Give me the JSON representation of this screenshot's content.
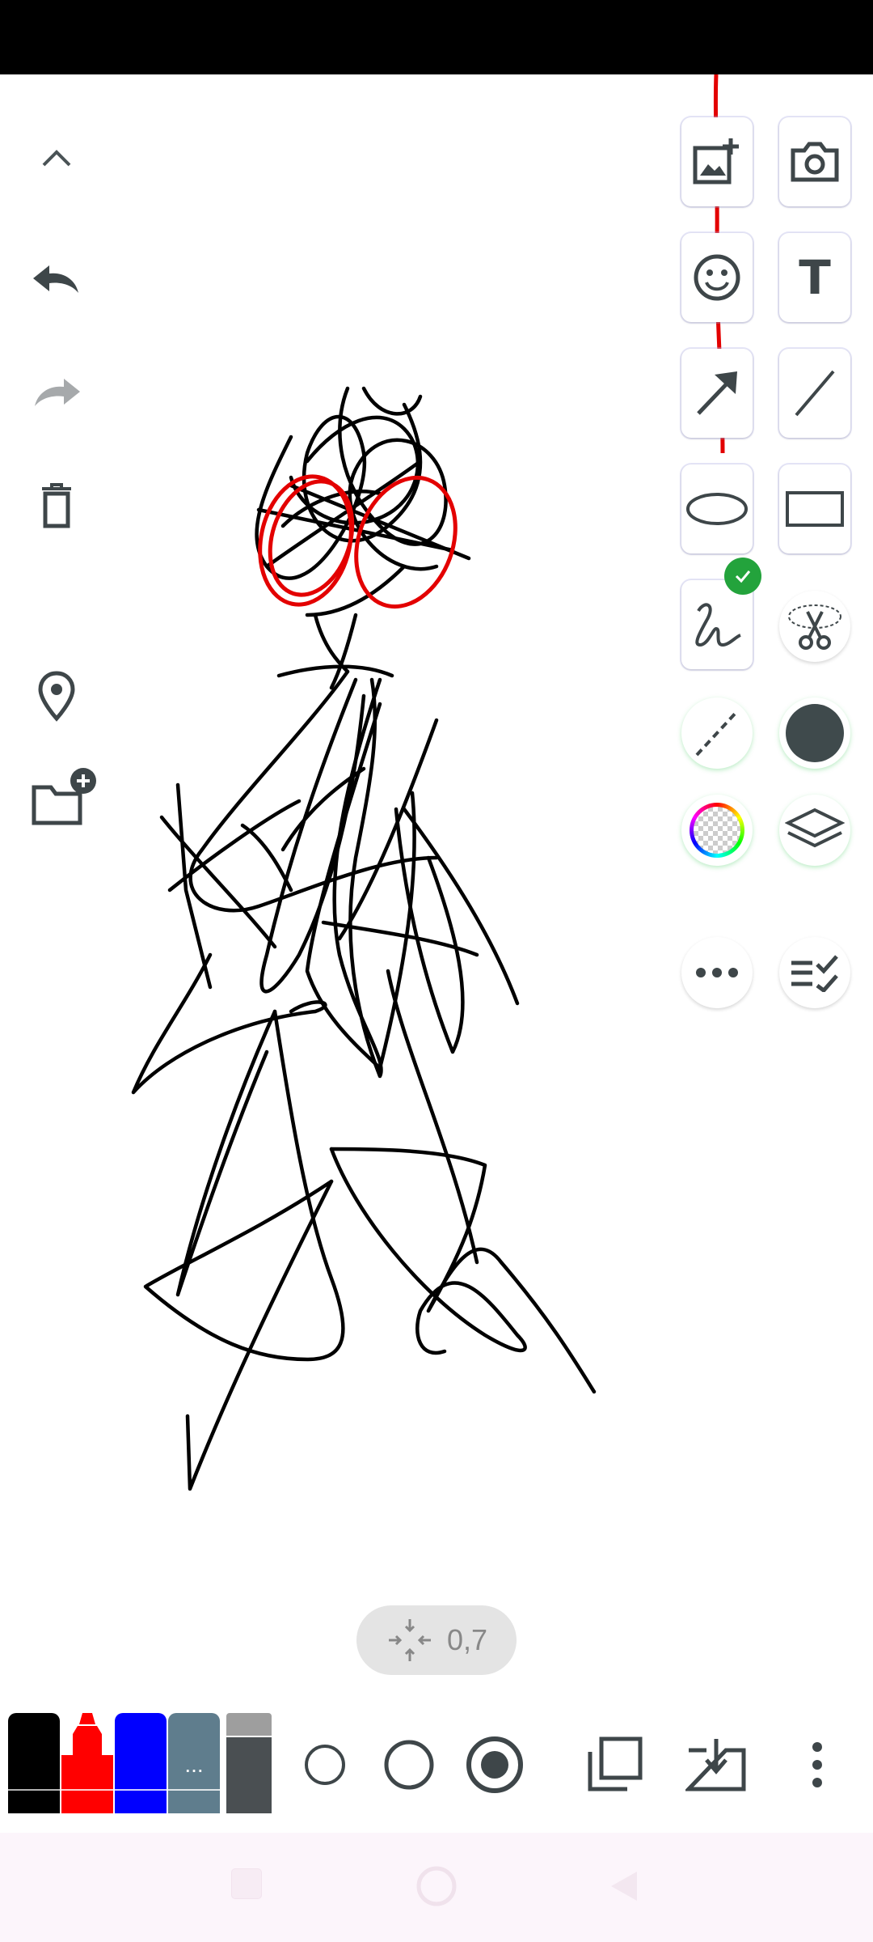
{
  "status_bar": {
    "background": "#000000"
  },
  "left_toolbar": {
    "icons": [
      "chevron-up-icon",
      "undo-icon",
      "redo-icon",
      "delete-icon",
      "location-pin-icon",
      "new-folder-icon"
    ]
  },
  "right_toolbar": {
    "tools": [
      "add-image",
      "camera",
      "emoji",
      "text",
      "arrow",
      "line",
      "ellipse",
      "rectangle",
      "freehand-pen",
      "lasso-cut",
      "dashed-line",
      "fill-color",
      "transparency",
      "layers",
      "more",
      "checklist"
    ],
    "text_tool_glyph": "T",
    "selected_tool": "freehand-pen",
    "selected_badge_color": "#23a33c",
    "fill_color": "#3f4a4c"
  },
  "zoom_indicator": {
    "value": "0,7"
  },
  "bottom_bar": {
    "pens": [
      {
        "name": "black-marker",
        "color": "#000000"
      },
      {
        "name": "red-marker",
        "color": "#ff0000"
      },
      {
        "name": "blue-marker",
        "color": "#0000ff"
      },
      {
        "name": "gray-blue-marker",
        "color": "#5f7d8d",
        "label": "..."
      },
      {
        "name": "eraser",
        "color": "#4a4f52"
      }
    ],
    "stroke_sizes": [
      "small",
      "medium",
      "large"
    ],
    "selected_stroke": "large",
    "actions": [
      "layers-copy-icon",
      "download-icon",
      "more-vert-icon"
    ]
  },
  "drawing": {
    "stroke_color": "#000000",
    "highlight_color": "#e30000"
  },
  "nav_bar": {
    "background": "#fcf5fb",
    "icons": [
      "recents-icon",
      "home-icon",
      "back-icon"
    ]
  }
}
